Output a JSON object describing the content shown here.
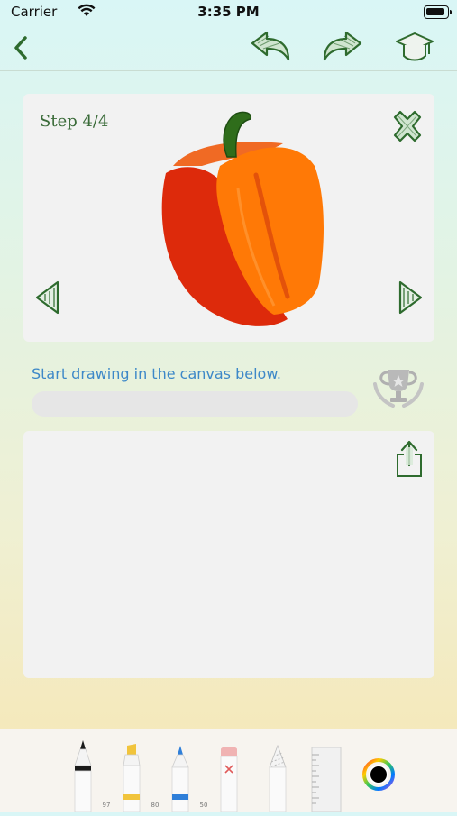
{
  "status_bar": {
    "carrier": "Carrier",
    "time": "3:35 PM"
  },
  "nav": {
    "back_icon": "chevron-left-icon",
    "undo_icon": "undo-arrow-icon",
    "redo_icon": "redo-arrow-icon",
    "learn_icon": "graduation-cap-icon"
  },
  "tutorial": {
    "step_label": "Step 4/4",
    "image": "bell-pepper-illustration",
    "close_icon": "close-x-icon",
    "prev_icon": "triangle-left-icon",
    "next_icon": "triangle-right-icon"
  },
  "instruction": {
    "text": "Start drawing in the canvas below.",
    "progress": 0,
    "trophy_icon": "trophy-icon"
  },
  "canvas": {
    "share_icon": "share-upload-icon"
  },
  "toolbar": {
    "tools": [
      {
        "name": "pen",
        "label": "97",
        "tip_color": "#1a1a1a"
      },
      {
        "name": "marker",
        "label": "80",
        "tip_color": "#f1c43c"
      },
      {
        "name": "pencil",
        "label": "50",
        "tip_color": "#2f7fd9"
      },
      {
        "name": "eraser",
        "label": "",
        "tip_color": "#f0b3b3"
      },
      {
        "name": "lasso",
        "label": "",
        "tip_color": "#bbbbbb"
      },
      {
        "name": "ruler",
        "label": "",
        "tip_color": "#dddddd"
      }
    ],
    "color_picker_icon": "color-wheel-icon",
    "selected_color": "#000000"
  },
  "colors": {
    "accent_green": "#3a6b39",
    "instruction_blue": "#3d88c8"
  }
}
